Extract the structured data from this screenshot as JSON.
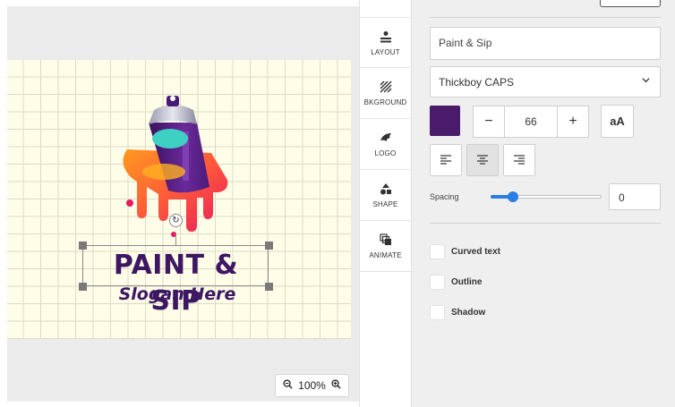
{
  "canvas": {
    "brand_text": "PAINT & SIP",
    "slogan_text": "Slogan Here",
    "zoom_level": "100%",
    "zoom_out_icon": "zoom-out-icon",
    "zoom_in_icon": "zoom-in-icon",
    "artboard_color": "#fdfde8"
  },
  "tabs": [
    {
      "label": "LAYOUT",
      "icon": "layout-icon"
    },
    {
      "label": "BKGROUND",
      "icon": "background-icon"
    },
    {
      "label": "LOGO",
      "icon": "logo-icon"
    },
    {
      "label": "SHAPE",
      "icon": "shape-icon"
    },
    {
      "label": "ANIMATE",
      "icon": "animate-icon"
    }
  ],
  "panel": {
    "text_value": "Paint & Sip",
    "font_name": "Thickboy CAPS",
    "color": "#4b1b6b",
    "font_size": "66",
    "minus_label": "−",
    "plus_label": "+",
    "case_label": "aA",
    "spacing_label": "Spacing",
    "spacing_value": "0",
    "spacing_slider_fraction": 0.2,
    "checks": [
      {
        "label": "Curved text",
        "checked": false
      },
      {
        "label": "Outline",
        "checked": false
      },
      {
        "label": "Shadow",
        "checked": false
      }
    ]
  }
}
